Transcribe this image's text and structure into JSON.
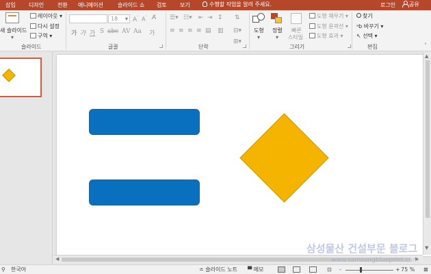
{
  "tabs": [
    "삽입",
    "디자인",
    "전환",
    "애니메이션",
    "슬라이드 쇼",
    "검토",
    "보기"
  ],
  "tell_me": "수행할 작업을 알려 주세요.",
  "account": {
    "login": "로그인",
    "share": "공유"
  },
  "ribbon": {
    "slides": {
      "new_slide": "새 슬라이드",
      "layout": "레이아웃",
      "reset": "다시 설정",
      "section": "구역",
      "label": "슬라이드"
    },
    "font": {
      "size": "18",
      "label": "글꼴"
    },
    "paragraph": {
      "label": "단락"
    },
    "drawing": {
      "shape": "도형",
      "arrange": "정렬",
      "quick_styles_line1": "빠른",
      "quick_styles_line2": "스타일",
      "fill": "도형 채우기",
      "outline": "도형 윤곽선",
      "effects": "도형 효과",
      "label": "그리기"
    },
    "editing": {
      "find": "찾기",
      "replace": "바꾸기",
      "select": "선택",
      "label": "편집"
    }
  },
  "status": {
    "language": "한국어",
    "notes": "슬라이드 노트",
    "comments": "메모",
    "zoom": "75 %"
  },
  "watermark": {
    "line1": "삼성물산 건설부문 블로그",
    "line2": "www.samsungblueprint.com"
  },
  "colors": {
    "accent": "#b7472a",
    "rect_fill": "#0970c0",
    "diamond_fill": "#f4b400"
  }
}
